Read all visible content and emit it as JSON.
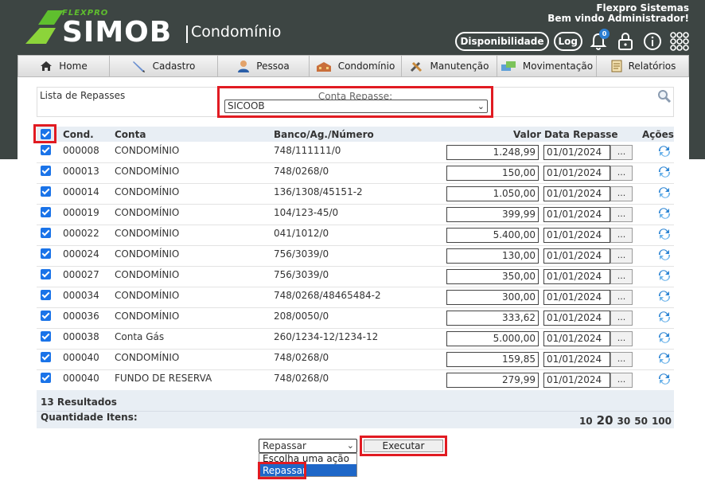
{
  "header": {
    "logo_brand": "FLEXPRO",
    "logo_name": "SIMOB",
    "logo_sub": "Condomínio",
    "company": "Flexpro Sistemas",
    "welcome": "Bem vindo Administrador!",
    "availability_button": "Disponibilidade",
    "log_button": "Log",
    "notification_count": "0"
  },
  "nav": {
    "items": [
      {
        "label": "Home",
        "icon": "home-icon"
      },
      {
        "label": "Cadastro",
        "icon": "pen-icon"
      },
      {
        "label": "Pessoa",
        "icon": "person-icon"
      },
      {
        "label": "Condomínio",
        "icon": "building-icon"
      },
      {
        "label": "Manutenção",
        "icon": "tools-icon"
      },
      {
        "label": "Movimentação",
        "icon": "transfer-icon"
      },
      {
        "label": "Relatórios",
        "icon": "report-icon"
      }
    ]
  },
  "filter": {
    "list_label": "Lista de Repasses",
    "account_label": "Conta Repasse:",
    "account_value": "SICOOB"
  },
  "table": {
    "headers": {
      "cond": "Cond.",
      "conta": "Conta",
      "banco": "Banco/Ag./Número",
      "valor": "Valor",
      "data": "Data Repasse",
      "acoes": "Ações"
    },
    "date_button": "...",
    "rows": [
      {
        "cond": "000008",
        "conta": "CONDOMÍNIO",
        "banco": "748/111111/0",
        "valor": "1.248,99",
        "data": "01/01/2024"
      },
      {
        "cond": "000013",
        "conta": "CONDOMÍNIO",
        "banco": "748/0268/0",
        "valor": "150,00",
        "data": "01/01/2024"
      },
      {
        "cond": "000014",
        "conta": "CONDOMÍNIO",
        "banco": "136/1308/45151-2",
        "valor": "1.050,00",
        "data": "01/01/2024"
      },
      {
        "cond": "000019",
        "conta": "CONDOMÍNIO",
        "banco": "104/123-45/0",
        "valor": "399,99",
        "data": "01/01/2024"
      },
      {
        "cond": "000022",
        "conta": "CONDOMÍNIO",
        "banco": "041/1012/0",
        "valor": "5.400,00",
        "data": "01/01/2024"
      },
      {
        "cond": "000024",
        "conta": "CONDOMÍNIO",
        "banco": "756/3039/0",
        "valor": "130,00",
        "data": "01/01/2024"
      },
      {
        "cond": "000027",
        "conta": "CONDOMÍNIO",
        "banco": "756/3039/0",
        "valor": "350,00",
        "data": "01/01/2024"
      },
      {
        "cond": "000034",
        "conta": "CONDOMÍNIO",
        "banco": "748/0268/48465484-2",
        "valor": "300,00",
        "data": "01/01/2024"
      },
      {
        "cond": "000036",
        "conta": "CONDOMÍNIO",
        "banco": "208/0050/0",
        "valor": "333,62",
        "data": "01/01/2024"
      },
      {
        "cond": "000038",
        "conta": "Conta Gás",
        "banco": "260/1234-12/1234-12",
        "valor": "5.000,00",
        "data": "01/01/2024"
      },
      {
        "cond": "000040",
        "conta": "CONDOMÍNIO",
        "banco": "748/0268/0",
        "valor": "159,85",
        "data": "01/01/2024"
      },
      {
        "cond": "000040",
        "conta": "FUNDO DE RESERVA",
        "banco": "748/0268/0",
        "valor": "279,99",
        "data": "01/01/2024"
      }
    ]
  },
  "footer": {
    "results": "13 Resultados",
    "quantity_label": "Quantidade Itens:",
    "page_sizes": [
      "10",
      "20",
      "30",
      "50",
      "100"
    ],
    "selected_page_size": "20"
  },
  "action": {
    "selected": "Repassar",
    "options": [
      "Escolha uma ação",
      "Repassar"
    ],
    "execute_button": "Executar"
  },
  "colors": {
    "header_bg": "#3d4543",
    "brand_green": "#5fbf2e",
    "checkbox_blue": "#1a73e8",
    "highlight_red": "#e11b22",
    "table_head_bg": "#e8eef4"
  }
}
